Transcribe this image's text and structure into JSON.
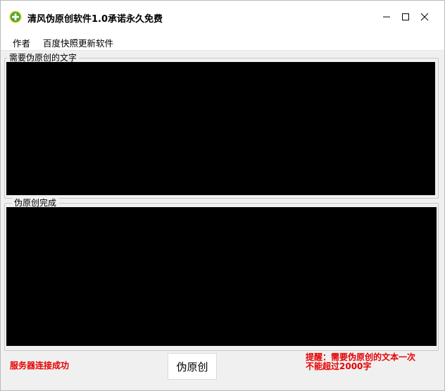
{
  "window": {
    "title": "清风伪原创软件1.0承诺永久免费",
    "icon": "qingfeng-app-icon"
  },
  "menu": {
    "items": [
      {
        "label": "作者"
      },
      {
        "label": "百度快照更新软件"
      }
    ]
  },
  "input_section": {
    "label": "需要伪原创的文字",
    "value": ""
  },
  "output_section": {
    "label": "伪原创完成",
    "value": ""
  },
  "status": {
    "connection": "服务器连接成功"
  },
  "actions": {
    "rewrite_label": "伪原创"
  },
  "notice": {
    "line1": "提醒：需要伪原创的文本一次",
    "line2": "不能超过2000字"
  },
  "colors": {
    "status_red": "#e60000",
    "textarea_bg": "#000000",
    "window_bg": "#f0f0f0"
  }
}
